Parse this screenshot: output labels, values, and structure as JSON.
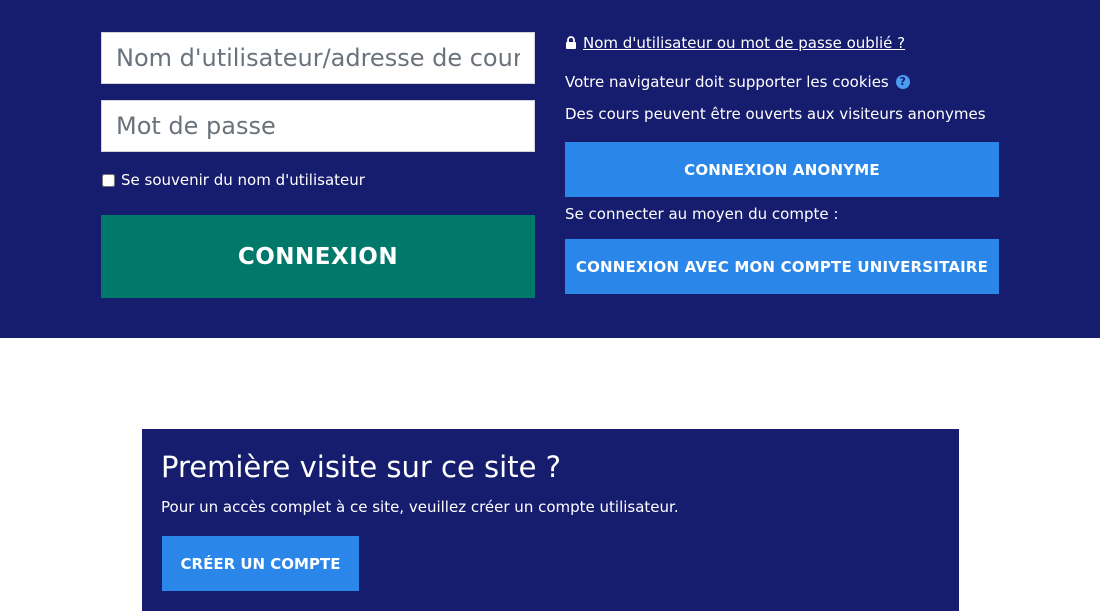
{
  "login": {
    "username_placeholder": "Nom d'utilisateur/adresse de courriel",
    "username_value": "",
    "password_placeholder": "Mot de passe",
    "password_value": "",
    "remember_label": "Se souvenir du nom d'utilisateur",
    "submit_label": "CONNEXION"
  },
  "side": {
    "forgot_label": "Nom d'utilisateur ou mot de passe oublié ?",
    "cookies_text": "Votre navigateur doit supporter les cookies",
    "help_icon": "?",
    "guest_text": "Des cours peuvent être ouverts aux visiteurs anonymes",
    "guest_button": "CONNEXION ANONYME",
    "connect_via_text": "Se connecter au moyen du compte :",
    "sso_button": "CONNEXION AVEC MON COMPTE UNIVERSITAIRE"
  },
  "signup": {
    "title": "Première visite sur ce site ?",
    "description": "Pour un accès complet à ce site, veuillez créer un compte utilisateur.",
    "button": "CRÉER UN COMPTE"
  },
  "colors": {
    "band": "#161d6f",
    "login_button": "#00796b",
    "blue_button": "#2a86e9"
  },
  "icons": {
    "lock": "lock-icon",
    "help": "question-circle-icon"
  }
}
